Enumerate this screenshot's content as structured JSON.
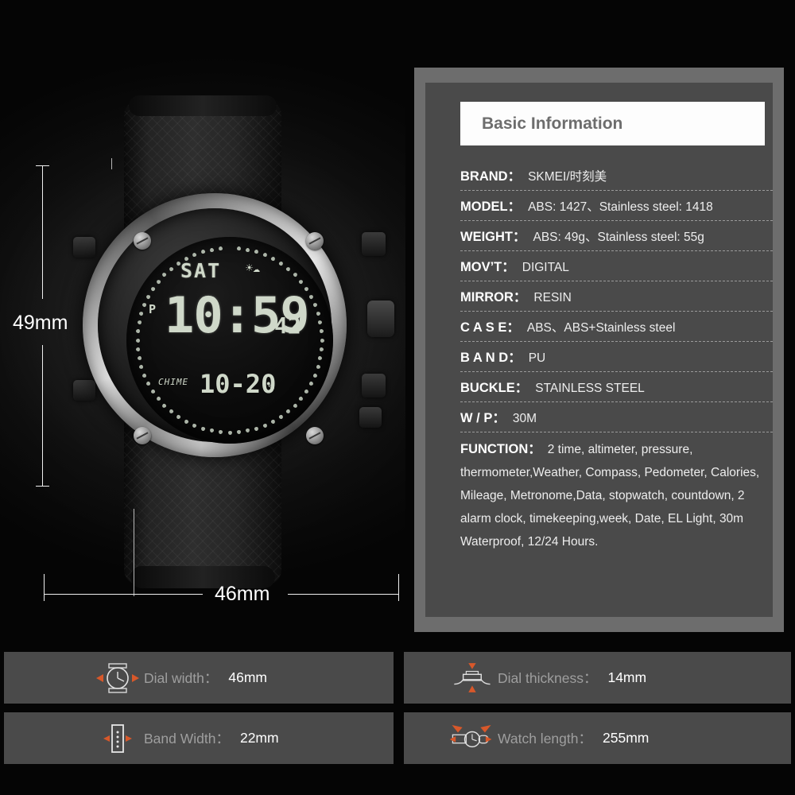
{
  "product_photo": {
    "alt_name": "skmei-digital-watch",
    "dimensions": {
      "height_label": "49mm",
      "width_label": "46mm"
    },
    "watch_display": {
      "day": "SAT",
      "weather_icon": "☀☁",
      "pm_indicator": "P",
      "time": "10:59",
      "seconds": "42",
      "chime_label": "CHIME",
      "date": "10-20",
      "alarm_icon": "◁"
    }
  },
  "spec_panel": {
    "title": "Basic Information",
    "rows": [
      {
        "key": "BRAND：",
        "value": "SKMEI/时刻美"
      },
      {
        "key": "MODEL：",
        "value": "ABS: 1427、Stainless steel: 1418"
      },
      {
        "key": "WEIGHT：",
        "value": "ABS: 49g、Stainless steel: 55g"
      },
      {
        "key": "MOV’T：",
        "value": "DIGITAL"
      },
      {
        "key": "MIRROR：",
        "value": "RESIN"
      },
      {
        "key": "C A S E：",
        "value": "ABS、ABS+Stainless steel"
      },
      {
        "key": "B A N D：",
        "value": "PU"
      },
      {
        "key": "BUCKLE：",
        "value": "STAINLESS STEEL"
      },
      {
        "key": "W / P：",
        "value": "30M"
      }
    ],
    "function_row": {
      "key": "FUNCTION：",
      "value": "2 time, altimeter, pressure, thermometer,Weather, Compass, Pedometer, Calories, Mileage, Metronome,Data, stopwatch, countdown, 2 alarm clock, timekeeping,week, Date, EL Light, 30m Waterproof, 12/24 Hours."
    }
  },
  "measure_bars": [
    {
      "icon": "watch-face-width-icon",
      "label": "Dial width：",
      "value": "46mm"
    },
    {
      "icon": "watch-profile-height-icon",
      "label": "Dial thickness：",
      "value": "14mm"
    },
    {
      "icon": "band-width-icon",
      "label": "Band Width：",
      "value": "22mm"
    },
    {
      "icon": "watch-length-icon",
      "label": "Watch length：",
      "value": "255mm"
    }
  ],
  "colors": {
    "background": "#050505",
    "panel_frame": "#6d6d6d",
    "panel_body": "#4a4a4a",
    "title_bar": "#fdfdfd",
    "accent_orange": "#d8582a",
    "lcd_green": "#cfd8c9"
  }
}
